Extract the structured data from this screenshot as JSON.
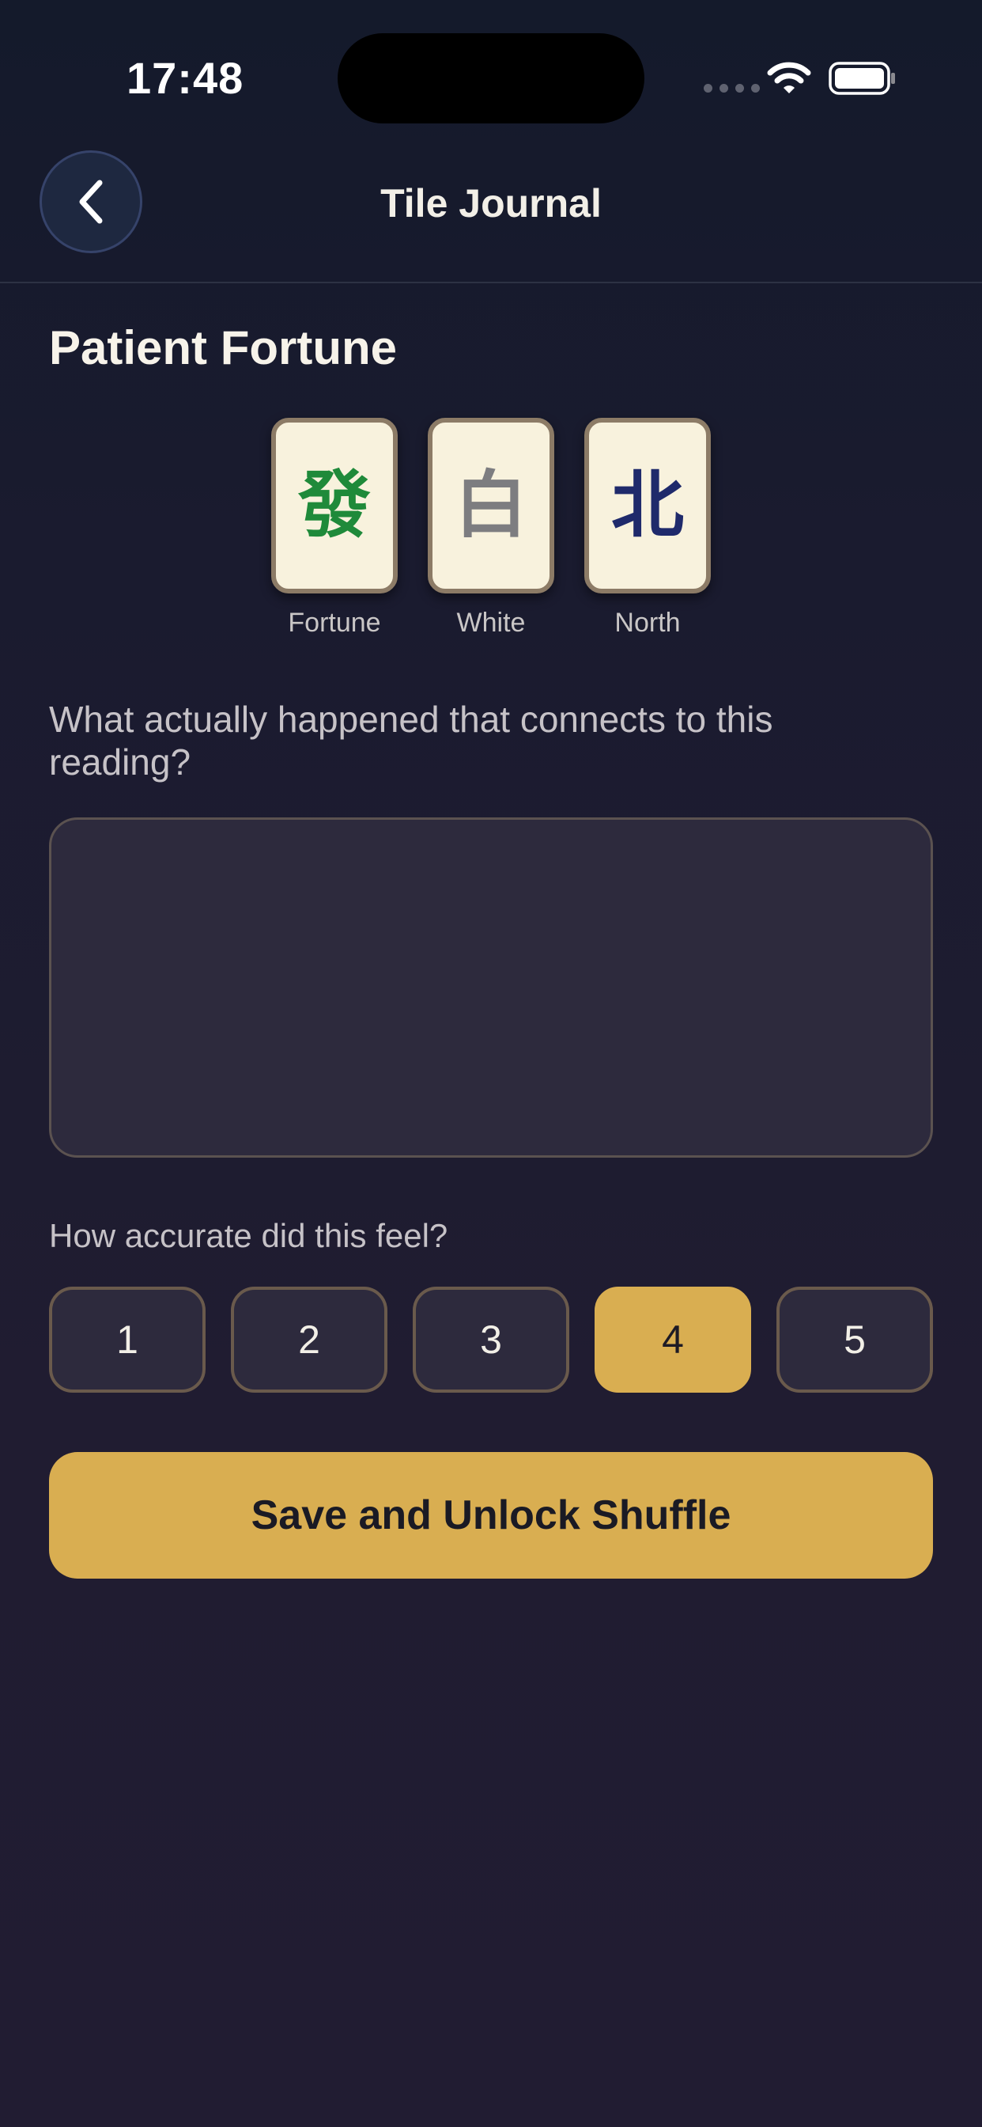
{
  "status_bar": {
    "time": "17:48"
  },
  "header": {
    "title": "Tile Journal",
    "back_icon": "chevron-left-icon"
  },
  "reading": {
    "title": "Patient Fortune",
    "tiles": [
      {
        "glyph": "發",
        "label": "Fortune",
        "color": "#1f8a3a"
      },
      {
        "glyph": "白",
        "label": "White",
        "color": "#7d7d80"
      },
      {
        "glyph": "北",
        "label": "North",
        "color": "#1f2a6b"
      }
    ]
  },
  "journal": {
    "question": "What actually happened that connects to this reading?",
    "entry_value": ""
  },
  "accuracy": {
    "label": "How accurate did this feel?",
    "options": [
      "1",
      "2",
      "3",
      "4",
      "5"
    ],
    "selected": "4"
  },
  "actions": {
    "save_label": "Save and Unlock Shuffle"
  },
  "colors": {
    "accent": "#d9ae51",
    "background": "#1a1b2f"
  }
}
